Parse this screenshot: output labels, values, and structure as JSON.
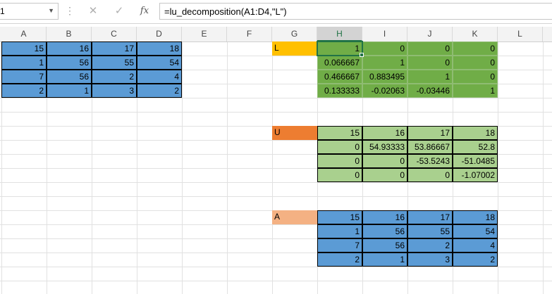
{
  "name_box": {
    "value": "1"
  },
  "formula_bar": {
    "cancel_icon": "✕",
    "enter_icon": "✓",
    "fx_icon": "fx",
    "formula": "=lu_decomposition(A1:D4,\"L\")"
  },
  "columns": [
    "A",
    "B",
    "C",
    "D",
    "E",
    "F",
    "G",
    "H",
    "I",
    "J",
    "K",
    "L"
  ],
  "selected_column": "H",
  "input": {
    "rows": [
      [
        "15",
        "16",
        "17",
        "18"
      ],
      [
        "1",
        "56",
        "55",
        "54"
      ],
      [
        "7",
        "56",
        "2",
        "4"
      ],
      [
        "2",
        "1",
        "3",
        "2"
      ]
    ]
  },
  "result_L": {
    "label": "L",
    "rows": [
      [
        "1",
        "0",
        "0",
        "0"
      ],
      [
        "0.066667",
        "1",
        "0",
        "0"
      ],
      [
        "0.466667",
        "0.883495",
        "1",
        "0"
      ],
      [
        "0.133333",
        "-0.02063",
        "-0.03446",
        "1"
      ]
    ]
  },
  "result_U": {
    "label": "U",
    "rows": [
      [
        "15",
        "16",
        "17",
        "18"
      ],
      [
        "0",
        "54.93333",
        "53.86667",
        "52.8"
      ],
      [
        "0",
        "0",
        "-53.5243",
        "-51.0485"
      ],
      [
        "0",
        "0",
        "0",
        "-1.07002"
      ]
    ]
  },
  "result_A": {
    "label": "A",
    "rows": [
      [
        "15",
        "16",
        "17",
        "18"
      ],
      [
        "1",
        "56",
        "55",
        "54"
      ],
      [
        "7",
        "56",
        "2",
        "4"
      ],
      [
        "2",
        "1",
        "3",
        "2"
      ]
    ]
  },
  "colors": {
    "blue": "#5b9bd5",
    "green": "#70ad47",
    "light_green": "#a9d08e",
    "label_L": "#ffc000",
    "label_U": "#ed7d31",
    "label_A": "#f4b183",
    "accent": "#217346"
  }
}
